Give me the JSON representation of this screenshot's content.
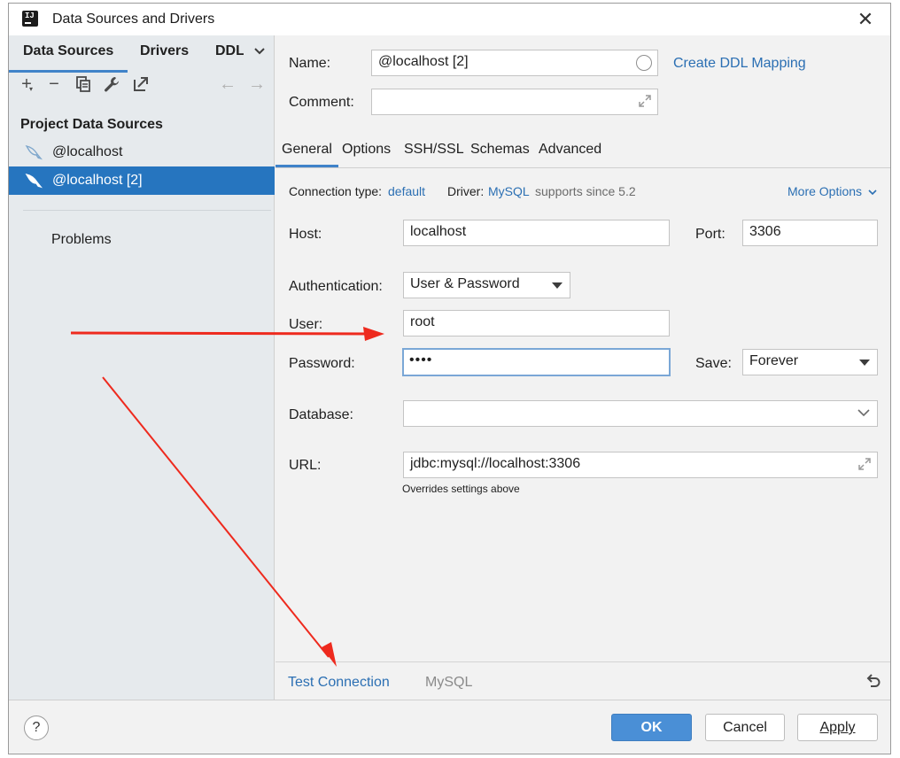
{
  "window": {
    "title": "Data Sources and Drivers"
  },
  "left_panel": {
    "tabs": [
      {
        "label": "Data Sources"
      },
      {
        "label": "Drivers"
      },
      {
        "label": "DDL"
      }
    ],
    "group_title": "Project Data Sources",
    "items": [
      {
        "label": "@localhost",
        "icon": "mysql-dolphin-icon"
      },
      {
        "label": "@localhost [2]",
        "icon": "mysql-dolphin-icon",
        "selected": true
      }
    ],
    "problems_label": "Problems"
  },
  "form": {
    "name_label": "Name:",
    "name_value": "@localhost [2]",
    "create_ddl_link": "Create DDL Mapping",
    "comment_label": "Comment:",
    "comment_value": ""
  },
  "tabs": [
    {
      "label": "General",
      "active": true
    },
    {
      "label": "Options"
    },
    {
      "label": "SSH/SSL"
    },
    {
      "label": "Schemas"
    },
    {
      "label": "Advanced"
    }
  ],
  "general": {
    "connection_type_label": "Connection type:",
    "connection_type_value": "default",
    "driver_label": "Driver:",
    "driver_value": "MySQL",
    "driver_note": "supports since 5.2",
    "more_options": "More Options",
    "host_label": "Host:",
    "host_value": "localhost",
    "port_label": "Port:",
    "port_value": "3306",
    "auth_label": "Authentication:",
    "auth_value": "User & Password",
    "user_label": "User:",
    "user_value": "root",
    "password_label": "Password:",
    "password_value": "••••",
    "save_label": "Save:",
    "save_value": "Forever",
    "database_label": "Database:",
    "database_value": "",
    "url_label": "URL:",
    "url_value": "jdbc:mysql://localhost:3306",
    "url_hint": "Overrides settings above"
  },
  "bottom_bar": {
    "test_connection": "Test Connection",
    "driver_name": "MySQL"
  },
  "footer": {
    "help": "?",
    "ok": "OK",
    "cancel": "Cancel",
    "apply": "Apply"
  },
  "colors": {
    "accent": "#2675bf",
    "link": "#2b6fb3",
    "annotation_arrow": "#ee2a1e"
  }
}
